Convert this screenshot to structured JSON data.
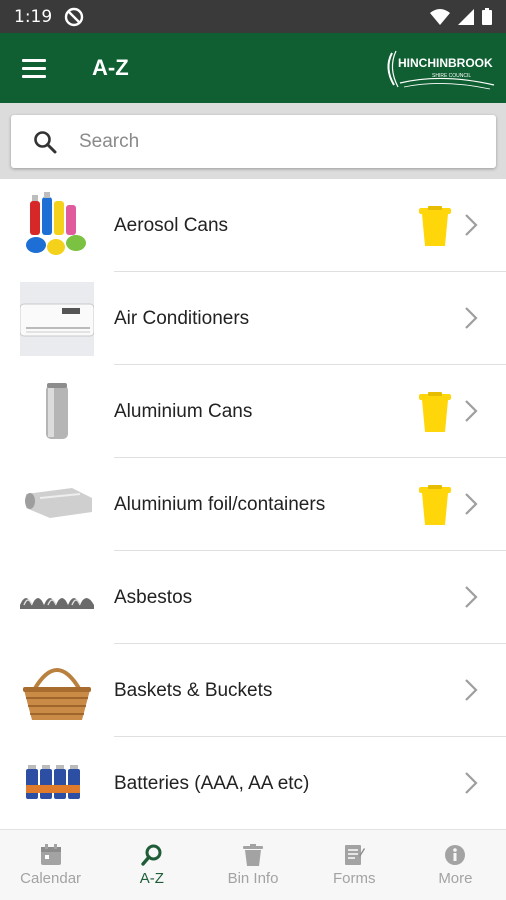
{
  "status": {
    "time": "1:19"
  },
  "appbar": {
    "title": "A-Z",
    "logo_text": "HINCHINBROOK",
    "logo_subtext": "SHIRE COUNCIL"
  },
  "search": {
    "placeholder": "Search",
    "value": ""
  },
  "items": [
    {
      "label": "Aerosol Cans",
      "icon": "aerosol-cans-image",
      "bin": true
    },
    {
      "label": "Air Conditioners",
      "icon": "air-conditioner-image",
      "bin": false
    },
    {
      "label": "Aluminium Cans",
      "icon": "aluminium-can-image",
      "bin": true
    },
    {
      "label": "Aluminium foil/containers",
      "icon": "aluminium-foil-image",
      "bin": true
    },
    {
      "label": "Asbestos",
      "icon": "asbestos-sheet-image",
      "bin": false
    },
    {
      "label": "Baskets & Buckets",
      "icon": "basket-image",
      "bin": false
    },
    {
      "label": "Batteries (AAA, AA etc)",
      "icon": "batteries-image",
      "bin": false
    }
  ],
  "bottom_nav": [
    {
      "label": "Calendar",
      "icon": "calendar-icon",
      "active": false
    },
    {
      "label": "A-Z",
      "icon": "search-icon",
      "active": true
    },
    {
      "label": "Bin Info",
      "icon": "bin-icon",
      "active": false
    },
    {
      "label": "Forms",
      "icon": "forms-icon",
      "active": false
    },
    {
      "label": "More",
      "icon": "info-icon",
      "active": false
    }
  ],
  "colors": {
    "primary": "#0f5f32",
    "status_bar": "#3a3a3a",
    "recycle_bin": "#ffd60a",
    "nav_active": "#1f5d38",
    "nav_inactive": "#a3a3a3"
  }
}
